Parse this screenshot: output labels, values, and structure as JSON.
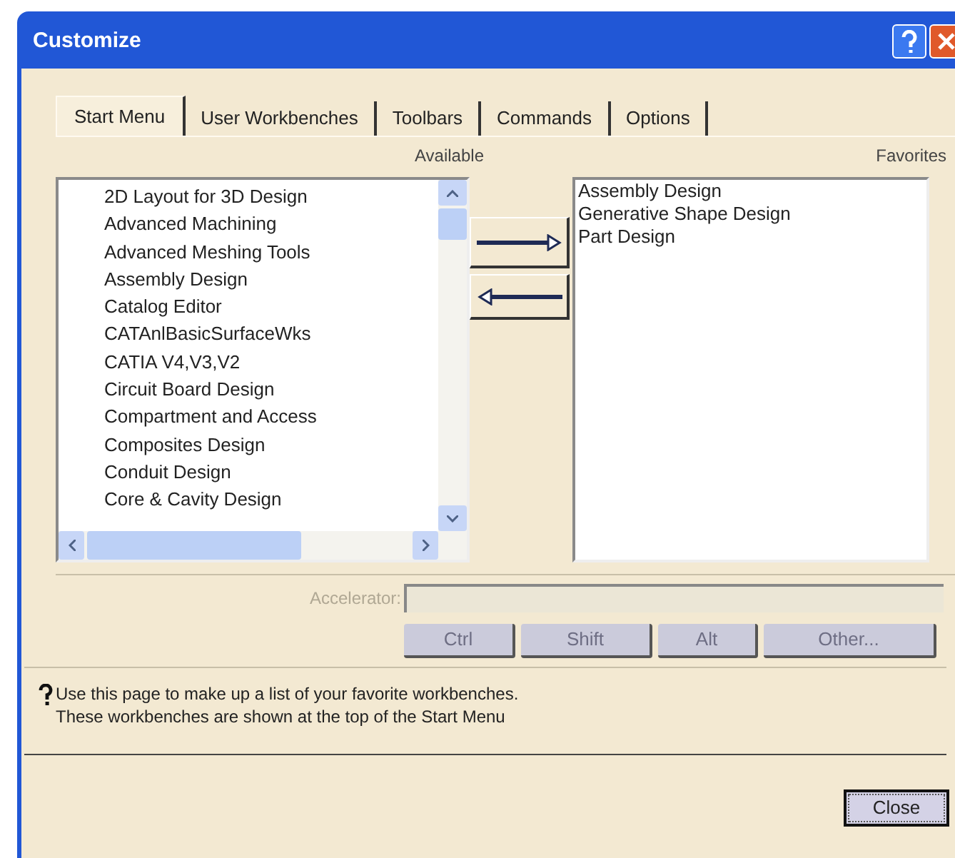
{
  "window": {
    "title": "Customize"
  },
  "tabs": [
    {
      "label": "Start Menu",
      "selected": true
    },
    {
      "label": "User Workbenches",
      "selected": false
    },
    {
      "label": "Toolbars",
      "selected": false
    },
    {
      "label": "Commands",
      "selected": false
    },
    {
      "label": "Options",
      "selected": false
    }
  ],
  "available": {
    "label": "Available",
    "items": [
      "2D Layout for 3D Design",
      "Advanced Machining",
      "Advanced Meshing Tools",
      "Assembly Design",
      "Catalog Editor",
      "CATAnlBasicSurfaceWks",
      "CATIA V4,V3,V2",
      "Circuit Board Design",
      "Compartment and Access",
      "Composites Design",
      "Conduit Design",
      "Core & Cavity Design"
    ]
  },
  "favorites": {
    "label": "Favorites",
    "items": [
      "Assembly Design",
      "Generative Shape Design",
      "Part Design"
    ]
  },
  "accelerator": {
    "label": "Accelerator:",
    "disabled": true
  },
  "modifier_buttons": [
    {
      "label": "Ctrl",
      "disabled": true
    },
    {
      "label": "Shift",
      "disabled": true
    },
    {
      "label": "Alt",
      "disabled": true
    },
    {
      "label": "Other...",
      "disabled": true
    }
  ],
  "info": [
    "Use this page to make up a list of your favorite workbenches.",
    "These workbenches are shown at the top of the Start Menu"
  ],
  "close_button": "Close"
}
